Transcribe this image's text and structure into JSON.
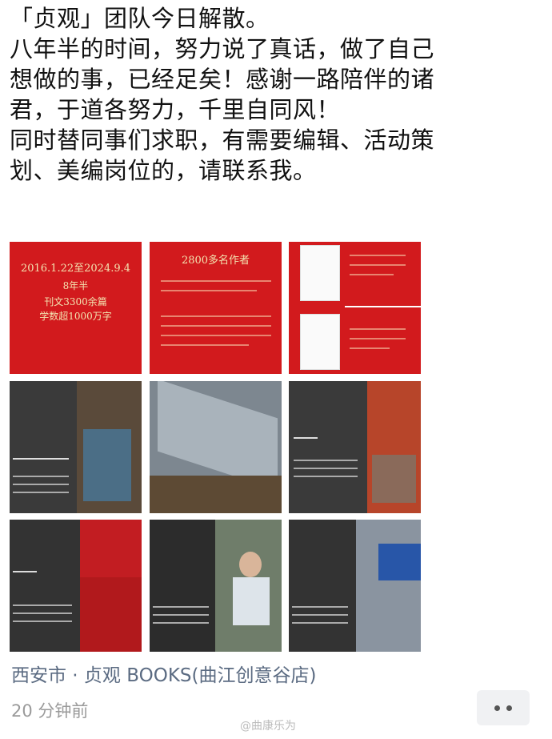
{
  "post": {
    "lines": [
      "「贞观」团队今日解散。",
      "八年半的时间，努力说了真话，做了自己",
      "想做的事，已经足矣！感谢一路陪伴的诸",
      "君，于道各努力，千里自同风！",
      "同时替同事们求职，有需要编辑、活动策",
      "划、美编岗位的，请联系我。"
    ]
  },
  "images": {
    "tile1": {
      "line1": "2016.1.22至2024.9.4",
      "line2": "8年半",
      "line3": "刊文3300余篇",
      "line4": "学数超1000万字"
    },
    "tile2": {
      "heading": "2800多名作者"
    }
  },
  "location": "西安市 · 贞观 BOOKS(曲江创意谷店)",
  "timestamp": "20 分钟前",
  "watermark": "@曲康乐为",
  "colors": {
    "tile_red": "#d21a1d",
    "tile_gray": "#3a3a3a",
    "link_blue": "#5b6b82"
  }
}
